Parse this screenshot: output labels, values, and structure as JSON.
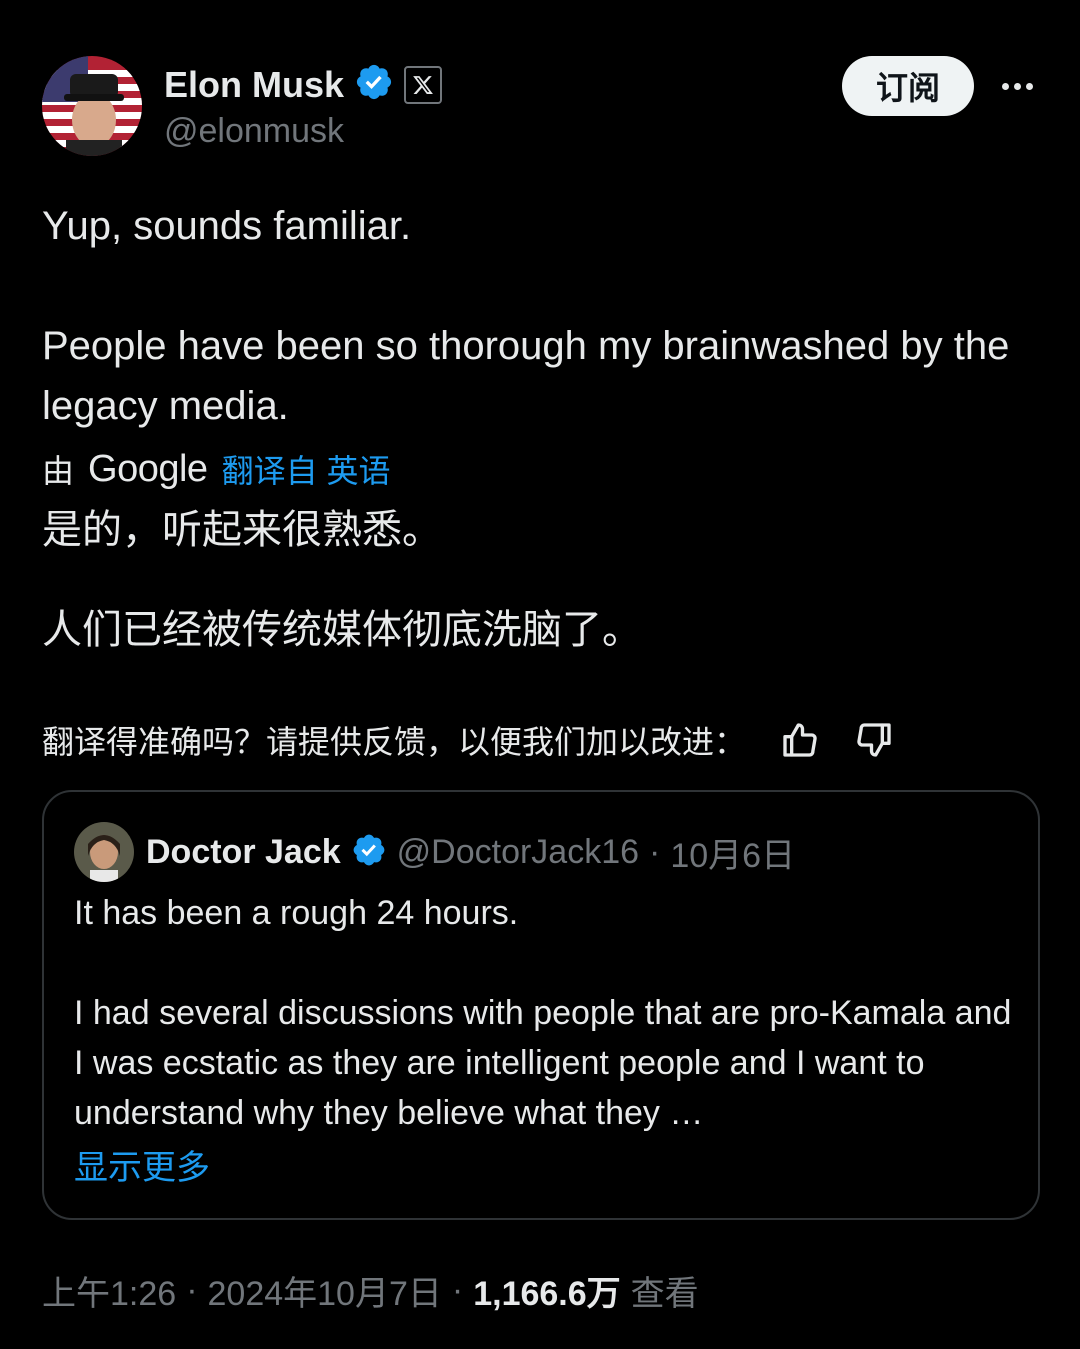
{
  "author": {
    "name": "Elon Musk",
    "handle": "@elonmusk"
  },
  "subscribe_label": "订阅",
  "tweet": {
    "paragraphs": [
      "Yup, sounds familiar.",
      "People have been so thorough my brainwashed by the legacy media."
    ]
  },
  "translation": {
    "by_label": "由",
    "provider": "Google",
    "link": "翻译自 英语",
    "paragraphs": [
      "是的，听起来很熟悉。",
      "人们已经被传统媒体彻底洗脑了。"
    ],
    "feedback_prompt": "翻译得准确吗？请提供反馈，以便我们加以改进："
  },
  "quoted": {
    "name": "Doctor Jack",
    "handle": "@DoctorJack16",
    "separator": "·",
    "date": "10月6日",
    "paragraphs": [
      "It has been a rough 24 hours.",
      "I had several discussions with people that are pro-Kamala and I was ecstatic as they are intelligent people and I want to understand why they believe what they …"
    ],
    "show_more": "显示更多"
  },
  "footer": {
    "time": "上午1:26",
    "date": "2024年10月7日",
    "views_count": "1,166.6万",
    "views_label": "查看",
    "separator": "·"
  },
  "colors": {
    "background": "#000000",
    "text": "#e7e9ea",
    "muted": "#71767b",
    "link": "#1d9bf0",
    "verified": "#1d9bf0",
    "border": "#2f3336"
  },
  "icons": [
    "verified-badge-icon",
    "x-logo-icon",
    "more-icon",
    "thumbs-up-icon",
    "thumbs-down-icon"
  ]
}
